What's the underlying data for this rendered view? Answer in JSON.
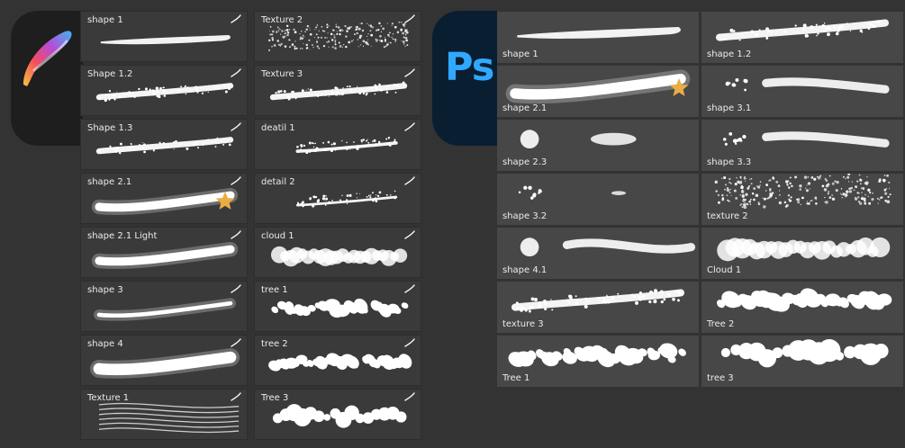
{
  "colors": {
    "background": "#333333",
    "procreate_tile": "#3a3a3a",
    "photoshop_tile": "#474747",
    "photoshop_accent": "#31a8ff",
    "favorite_star": "#e9ad44"
  },
  "procreate": {
    "icon": "procreate-logo-icon",
    "brushes": [
      {
        "label": "shape 1",
        "stroke": "taper"
      },
      {
        "label": "Shape 1.2",
        "stroke": "rough"
      },
      {
        "label": "Shape 1.3",
        "stroke": "speckle"
      },
      {
        "label": "shape 2.1",
        "stroke": "soft",
        "favorite": true
      },
      {
        "label": "shape 2.1 Light",
        "stroke": "soft"
      },
      {
        "label": "shape 3",
        "stroke": "soft-thin"
      },
      {
        "label": "shape 4",
        "stroke": "soft-wide"
      },
      {
        "label": "Texture 1",
        "stroke": "hair"
      },
      {
        "label": "Texture 2",
        "stroke": "noise"
      },
      {
        "label": "Texture 3",
        "stroke": "rough"
      },
      {
        "label": "deatil 1",
        "stroke": "detail"
      },
      {
        "label": "detail 2",
        "stroke": "detail-speckle"
      },
      {
        "label": "cloud 1",
        "stroke": "cloud"
      },
      {
        "label": "tree 1",
        "stroke": "foliage"
      },
      {
        "label": "tree 2",
        "stroke": "foliage-alt"
      },
      {
        "label": "Tree 3",
        "stroke": "blobs"
      }
    ]
  },
  "photoshop": {
    "icon_text": "Ps",
    "brushes": [
      {
        "label": "shape 1",
        "stroke": "taper"
      },
      {
        "label": "shape 1.2",
        "stroke": "taper-speckle"
      },
      {
        "label": "shape 2.1",
        "stroke": "soft",
        "favorite": true
      },
      {
        "label": "shape 3.1",
        "stroke": "dots-soft"
      },
      {
        "label": "shape 2.3",
        "stroke": "blob-short"
      },
      {
        "label": "shape 3.3",
        "stroke": "dots-speckle"
      },
      {
        "label": "shape 3.2",
        "stroke": "dots-small"
      },
      {
        "label": "texture 2",
        "stroke": "noise"
      },
      {
        "label": "shape 4.1",
        "stroke": "blob-soft"
      },
      {
        "label": "Cloud 1",
        "stroke": "cloud"
      },
      {
        "label": "texture 3",
        "stroke": "rough"
      },
      {
        "label": "Tree 2",
        "stroke": "foliage"
      },
      {
        "label": "Tree 1",
        "stroke": "foliage"
      },
      {
        "label": "tree 3",
        "stroke": "blobs"
      }
    ]
  }
}
